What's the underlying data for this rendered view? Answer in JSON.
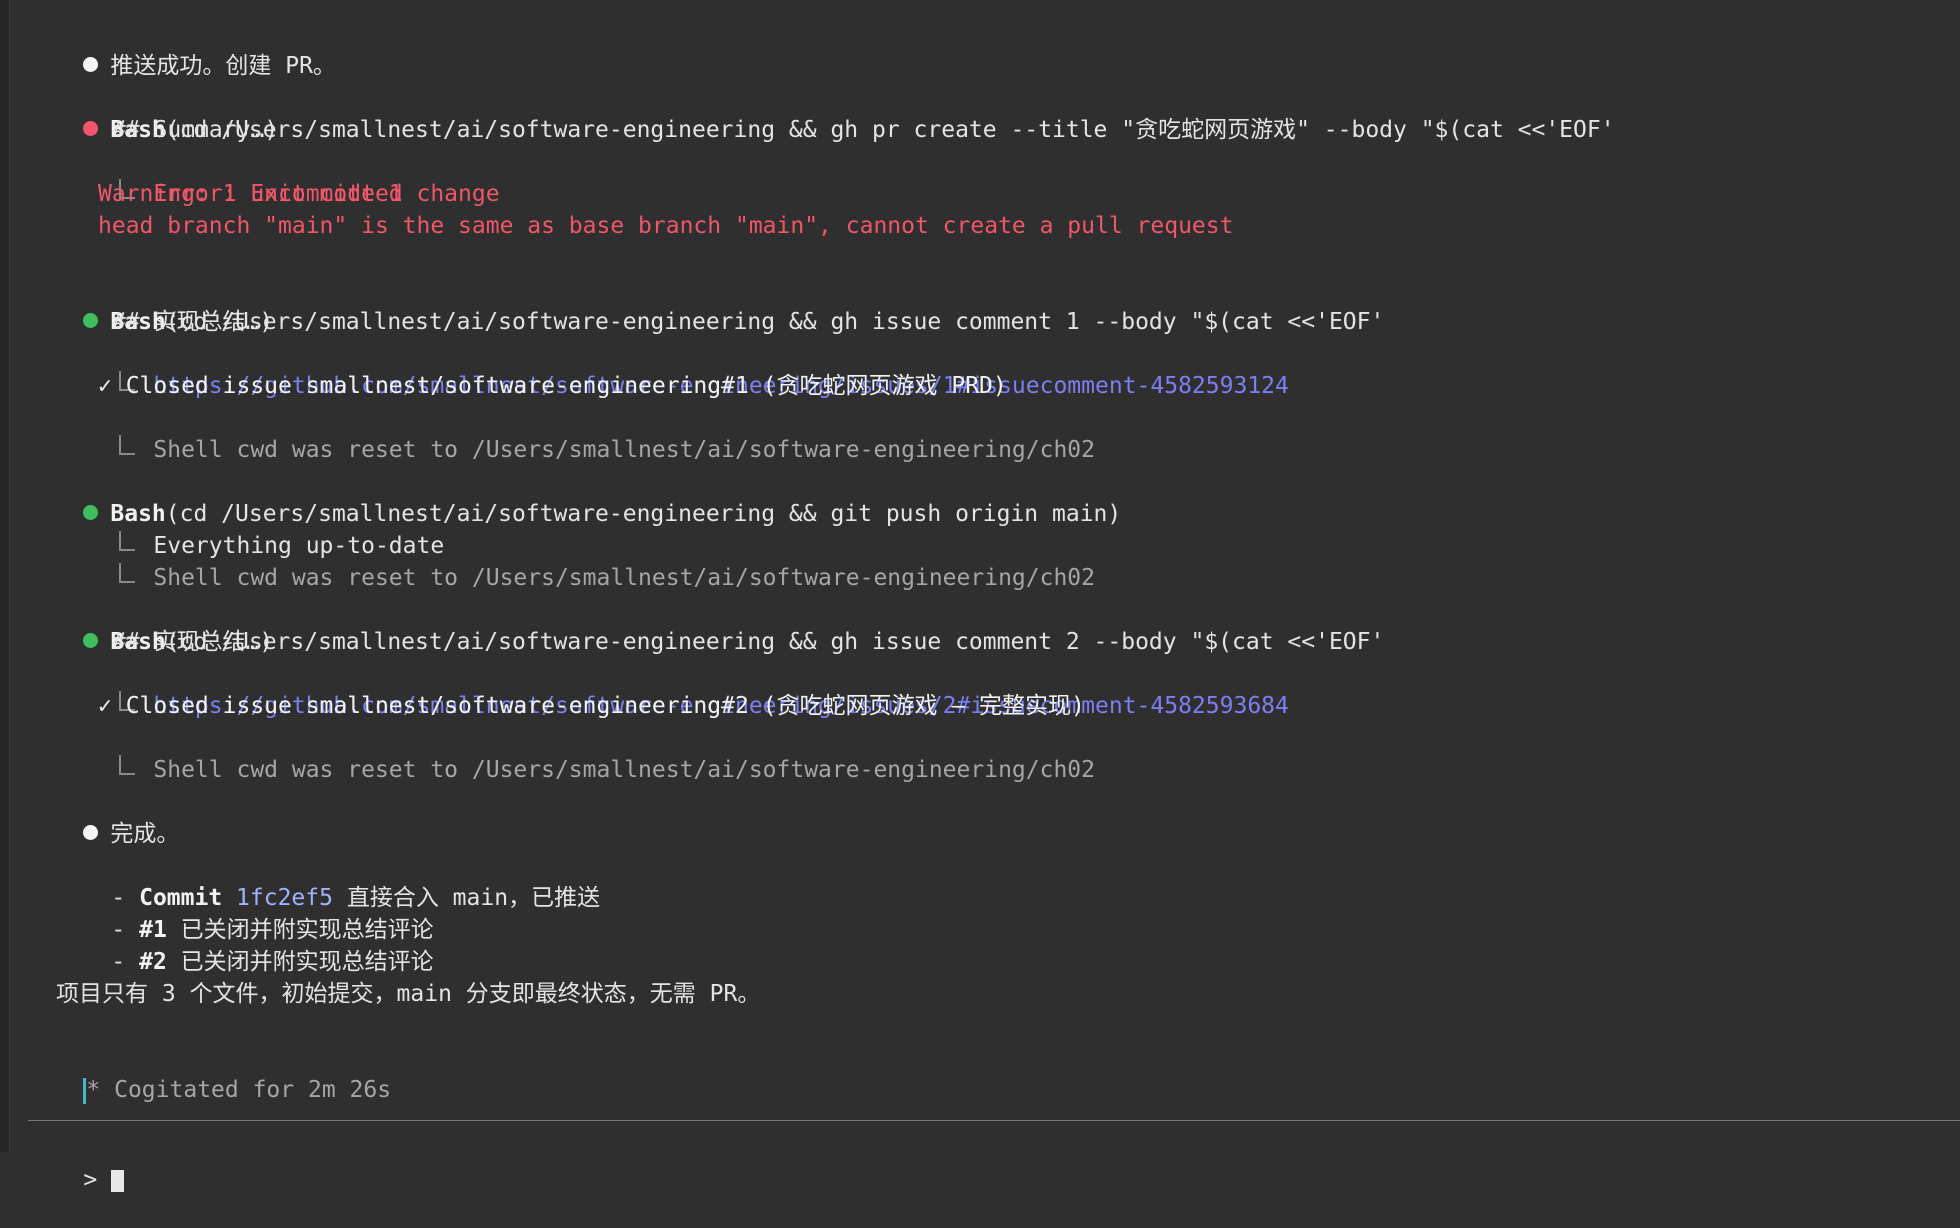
{
  "messages": [
    {
      "type": "text",
      "text": "推送成功。创建 PR。"
    },
    {
      "type": "tool",
      "status": "error",
      "tool": "Bash",
      "command": "(cd /Users/smallnest/ai/software-engineering && gh pr create --title \"贪吃蛇网页游戏\" --body \"$(cat <<'EOF'",
      "cont": "## Summary…)",
      "output": [
        "Error: Exit code 1",
        "Warning: 1 uncommitted change",
        "head branch \"main\" is the same as base branch \"main\", cannot create a pull request"
      ]
    },
    {
      "type": "tool",
      "status": "success",
      "tool": "Bash",
      "command": "(cd /Users/smallnest/ai/software-engineering && gh issue comment 1 --body \"$(cat <<'EOF'",
      "cont": "## 实现总结…)",
      "link": "https://github.com/smallnest/software-engineering/issues/1#issuecomment-4582593124",
      "closed": "✓ Closed issue smallnest/software-engineering#1 (贪吃蛇网页游戏 PRD)",
      "note": "Shell cwd was reset to /Users/smallnest/ai/software-engineering/ch02"
    },
    {
      "type": "tool",
      "status": "success",
      "tool": "Bash",
      "command": "(cd /Users/smallnest/ai/software-engineering && git push origin main)",
      "output": "Everything up-to-date",
      "note": "Shell cwd was reset to /Users/smallnest/ai/software-engineering/ch02"
    },
    {
      "type": "tool",
      "status": "success",
      "tool": "Bash",
      "command": "(cd /Users/smallnest/ai/software-engineering && gh issue comment 2 --body \"$(cat <<'EOF'",
      "cont": "## 实现总结…)",
      "link": "https://github.com/smallnest/software-engineering/issues/2#issuecomment-4582593684",
      "closed": "✓ Closed issue smallnest/software-engineering#2 (贪吃蛇网页游戏 — 完整实现)",
      "note": "Shell cwd was reset to /Users/smallnest/ai/software-engineering/ch02"
    },
    {
      "type": "text",
      "text": "完成。"
    }
  ],
  "summary": {
    "bullets": [
      {
        "dash": "- ",
        "bold": "Commit",
        "hash": "1fc2ef5",
        "rest": " 直接合入 main，已推送"
      },
      {
        "dash": "- ",
        "bold": "#1",
        "rest": " 已关闭并附实现总结评论"
      },
      {
        "dash": "- ",
        "bold": "#2",
        "rest": " 已关闭并附实现总结评论"
      }
    ],
    "final": "项目只有 3 个文件，初始提交，main 分支即最终状态，无需 PR。"
  },
  "status_line": {
    "glyph": "*",
    "text": "Cogitated for 2m 26s"
  },
  "prompt": {
    "symbol": ">"
  },
  "colors": {
    "background": "#2f2f2f",
    "error": "#f0566a",
    "success": "#3fbf5c",
    "link": "#7b7ff2",
    "dim": "#a6a6a6"
  }
}
